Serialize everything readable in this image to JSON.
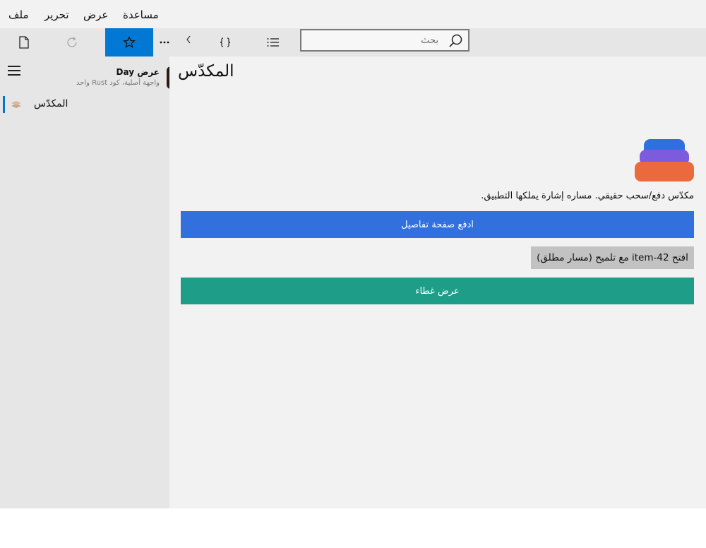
{
  "menu": {
    "items": [
      {
        "label": "ملف"
      },
      {
        "label": "تحرير"
      },
      {
        "label": "عرض"
      },
      {
        "label": "مساعدة"
      }
    ]
  },
  "toolbar": {
    "buttons": [
      {
        "icon": "new-document-icon"
      },
      {
        "icon": "refresh-icon"
      },
      {
        "icon": "star-icon",
        "active": true
      },
      {
        "icon": "more-icon"
      },
      {
        "icon": "chevron-left-icon"
      },
      {
        "icon": "braces-icon"
      },
      {
        "icon": "list-icon"
      }
    ],
    "search": {
      "placeholder": "بحث",
      "value": "",
      "icon": "search-icon"
    },
    "accent_color": "#0078d4"
  },
  "sidebar": {
    "app_title": "عرض Day",
    "app_subtitle": "واجهة أصلية، كود Rust واحد",
    "items": [
      {
        "label": "المكدّس",
        "icon": "layers-icon",
        "selected": true
      }
    ]
  },
  "main": {
    "title": "المكدّس",
    "description": "مكدّس دفع/سحب حقيقي. مساره إشارة يملكها التطبيق.",
    "buttons": {
      "push_details": "ادفع صفحة تفاصيل",
      "open_item": "افتح item-42 مع تلميح (مسار مطلق)",
      "show_sheet": "عرض غطاء"
    },
    "colors": {
      "primary_button": "#3170dd",
      "secondary_button": "#c2c2c2",
      "teal_button": "#1e9e88",
      "stack_top": "#2f6fde",
      "stack_middle": "#7c5cdc",
      "stack_bottom": "#ea6a3e"
    }
  }
}
